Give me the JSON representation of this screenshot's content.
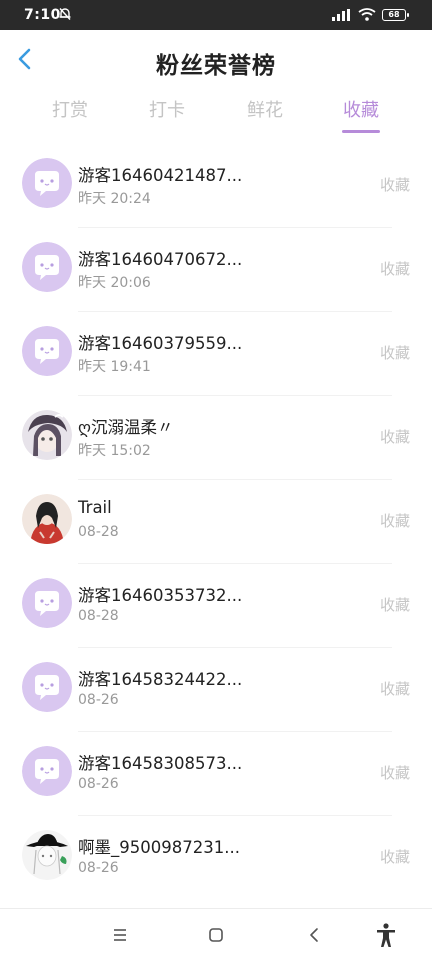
{
  "status_bar": {
    "time": "7:10",
    "battery": "68"
  },
  "header": {
    "title": "粉丝荣誉榜"
  },
  "tabs": [
    {
      "label": "打赏"
    },
    {
      "label": "打卡"
    },
    {
      "label": "鲜花"
    },
    {
      "label": "收藏",
      "active": true
    }
  ],
  "list": [
    {
      "name": "游客16460421487...",
      "time": "昨天 20:24",
      "action": "收藏"
    },
    {
      "name": "游客16460470672...",
      "time": "昨天 20:06",
      "action": "收藏"
    },
    {
      "name": "游客16460379559...",
      "time": "昨天 19:41",
      "action": "收藏"
    },
    {
      "name": "ღ沉溺温柔〃",
      "time": "昨天 15:02",
      "action": "收藏"
    },
    {
      "name": "Trail",
      "time": "08-28",
      "action": "收藏"
    },
    {
      "name": "游客16460353732...",
      "time": "08-28",
      "action": "收藏"
    },
    {
      "name": "游客16458324422...",
      "time": "08-26",
      "action": "收藏"
    },
    {
      "name": "游客16458308573...",
      "time": "08-26",
      "action": "收藏"
    },
    {
      "name": "啊墨_9500987231...",
      "time": "08-26",
      "action": "收藏"
    }
  ],
  "colors": {
    "accent": "#b68bd9",
    "avatar_purple": "#d9c7f0",
    "inactive_tab": "#c4c4c4"
  },
  "icons": {
    "back": "chevron-left-icon",
    "default_avatar": "chat-bubble-avatar-icon",
    "nav": [
      "menu-icon",
      "home-icon",
      "back-icon",
      "accessibility-icon"
    ]
  }
}
